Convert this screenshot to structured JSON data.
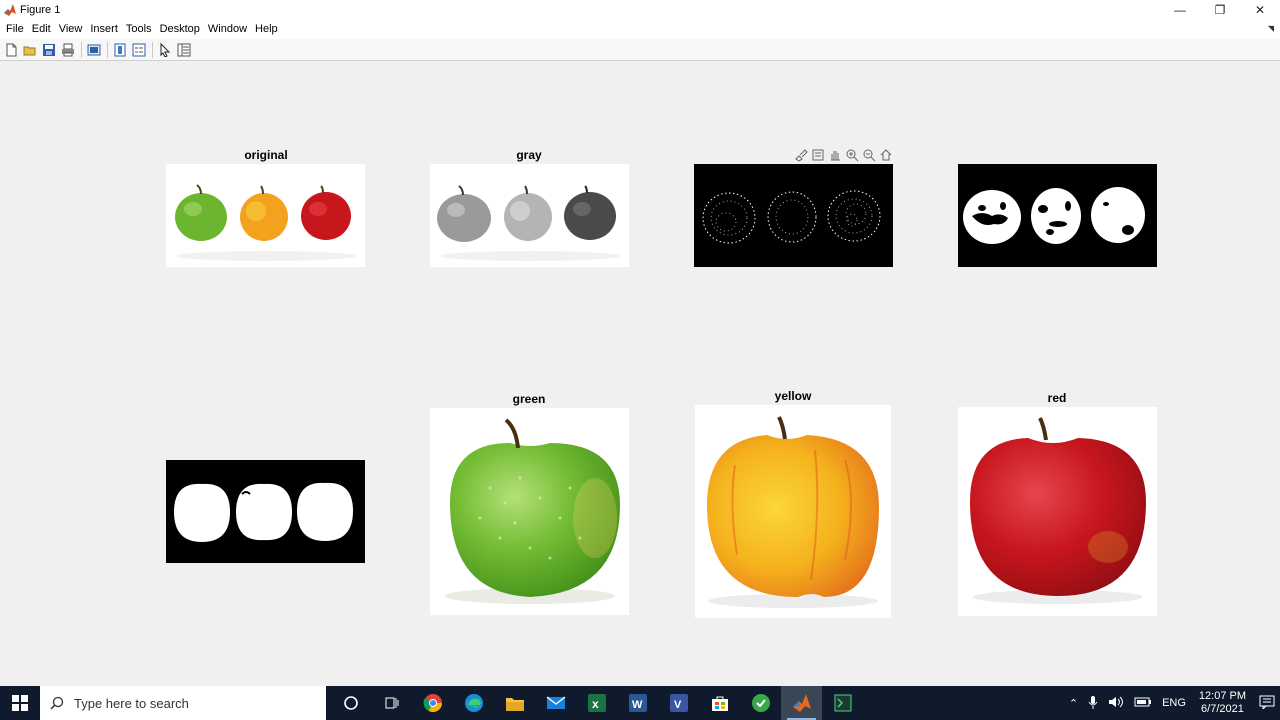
{
  "window": {
    "title": "Figure 1",
    "controls": {
      "minimize": "—",
      "restore": "❐",
      "close": "✕"
    }
  },
  "menu": [
    "File",
    "Edit",
    "View",
    "Insert",
    "Tools",
    "Desktop",
    "Window",
    "Help"
  ],
  "toolbar": {
    "icons": [
      "new-figure-icon",
      "open-file-icon",
      "save-icon",
      "print-icon",
      "link-plot-icon",
      "insert-colorbar-icon",
      "insert-legend-icon",
      "edit-plot-icon",
      "property-inspector-icon"
    ]
  },
  "axes_toolbar": {
    "icons": [
      "brush-icon",
      "data-tips-icon",
      "pan-icon",
      "zoom-in-icon",
      "zoom-out-icon",
      "home-icon"
    ]
  },
  "subplots": {
    "original": "original",
    "gray": "gray",
    "edges": "",
    "binary": "",
    "mask": "",
    "green": "green",
    "yellow": "yellow",
    "red": "red"
  },
  "colors": {
    "green_apple": "#6cb52e",
    "yellow_apple": "#f3a21d",
    "red_apple": "#c8161d",
    "taskbar": "#0f1b2d"
  },
  "taskbar": {
    "search_placeholder": "Type here to search",
    "apps": [
      "cortana-icon",
      "task-view-icon",
      "chrome-icon",
      "edge-icon",
      "file-explorer-icon",
      "mail-icon",
      "excel-icon",
      "word-icon",
      "visio-icon",
      "store-icon",
      "app-icon",
      "matlab-icon",
      "terminal-icon"
    ],
    "language": "ENG",
    "time": "12:07 PM",
    "date": "6/7/2021"
  }
}
